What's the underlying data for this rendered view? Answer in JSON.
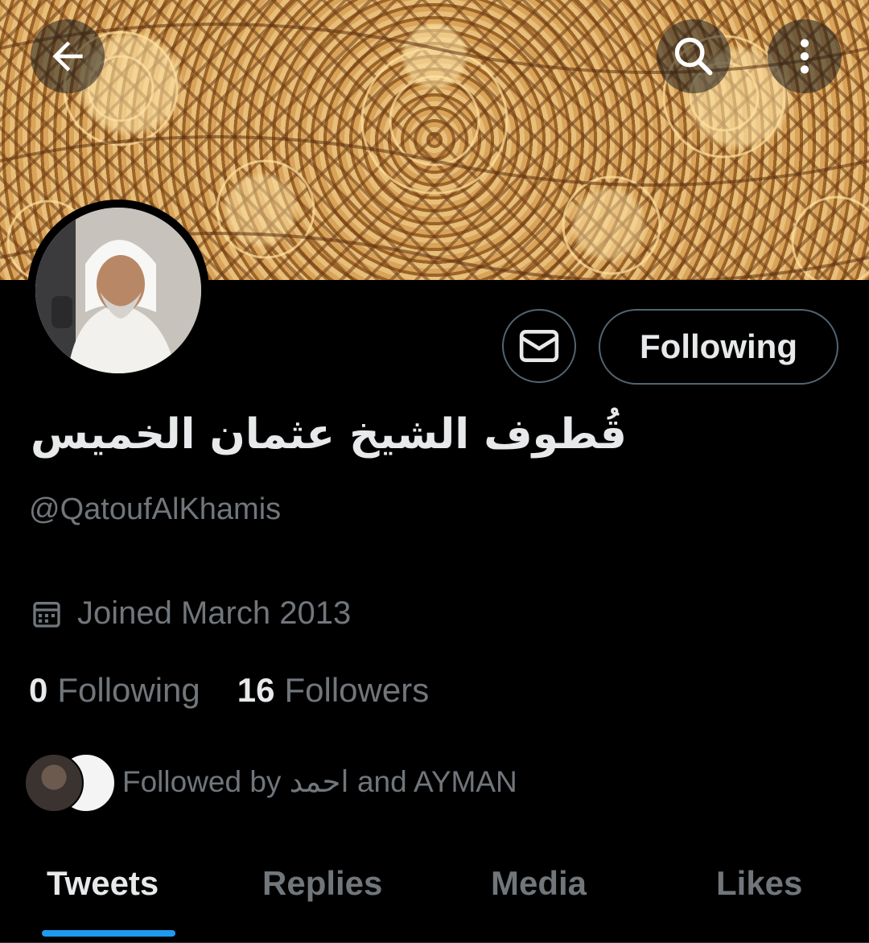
{
  "header": {
    "back_icon": "arrow-left-icon",
    "search_icon": "search-icon",
    "more_icon": "more-vertical-icon"
  },
  "profile": {
    "display_name": "قُطوف الشيخ عثمان الخميس",
    "handle": "@QatoufAlKhamis",
    "joined": "Joined March 2013",
    "following_button": "Following",
    "message_icon": "envelope-icon"
  },
  "stats": {
    "following_count": "0",
    "following_label": "Following",
    "followers_count": "16",
    "followers_label": "Followers"
  },
  "followed_by": {
    "text": "Followed by احمد and AYMAN"
  },
  "tabs": [
    {
      "label": "Tweets"
    },
    {
      "label": "Replies"
    },
    {
      "label": "Media"
    },
    {
      "label": "Likes"
    }
  ],
  "colors": {
    "accent": "#1d9bf0",
    "background": "#000000",
    "primary_text": "#e7e9ea",
    "secondary_text": "#71767b",
    "border": "#536471"
  }
}
